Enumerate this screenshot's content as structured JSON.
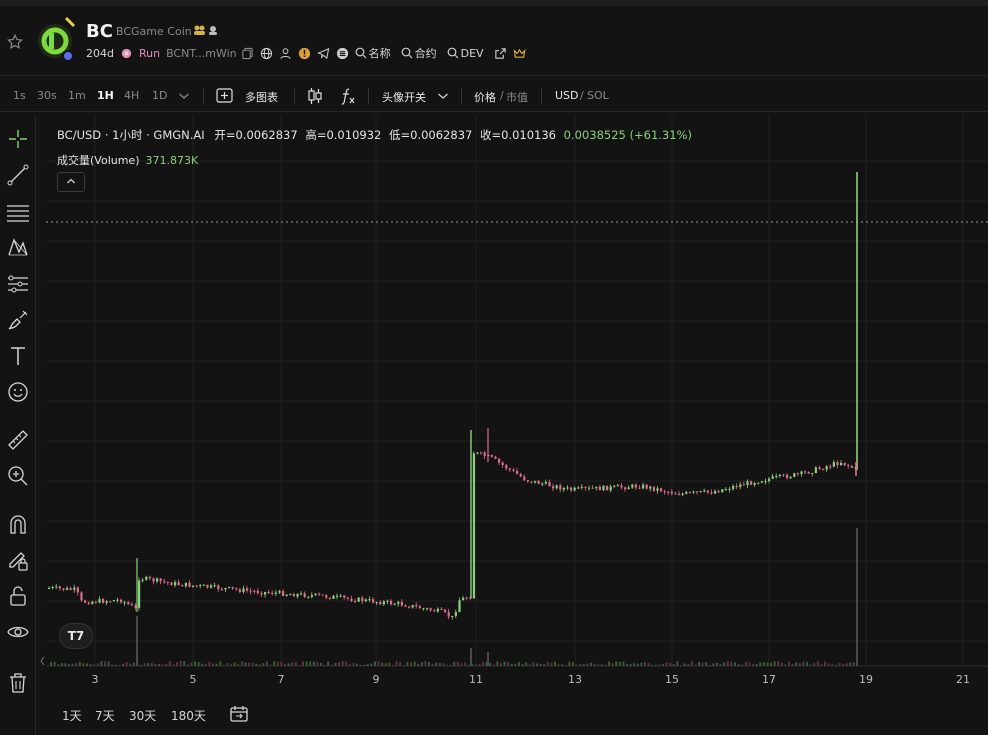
{
  "header": {
    "symbol": "BC",
    "name": "BCGame Coin",
    "age": "204d",
    "status": "Run",
    "address": "BCNT...mWin",
    "links": {
      "name": "名称",
      "contract": "合约",
      "dev": "DEV"
    }
  },
  "toolbar": {
    "timeframes": [
      "1s",
      "30s",
      "1m",
      "1H",
      "4H",
      "1D"
    ],
    "active_timeframe": "1H",
    "multi_chart": "多图表",
    "avatar_toggle": "头像开关",
    "price": "价格",
    "market_cap": "市值",
    "currency_usd": "USD",
    "currency_sol": "SOL"
  },
  "legend": {
    "pair": "BC/USD · 1小时 · GMGN.AI",
    "open": "开=0.0062837",
    "high": "高=0.010932",
    "low": "低=0.0062837",
    "close": "收=0.010136",
    "change": "0.0038525 (+61.31%)",
    "volume_label": "成交量(Volume)",
    "volume_value": "371.873K"
  },
  "x_axis": [
    "3",
    "5",
    "7",
    "9",
    "11",
    "13",
    "15",
    "17",
    "19",
    "21"
  ],
  "ranges": [
    "1天",
    "7天",
    "30天",
    "180天"
  ],
  "colors": {
    "up": "#8bd07b",
    "down": "#e06b8b",
    "background": "#131313"
  }
}
